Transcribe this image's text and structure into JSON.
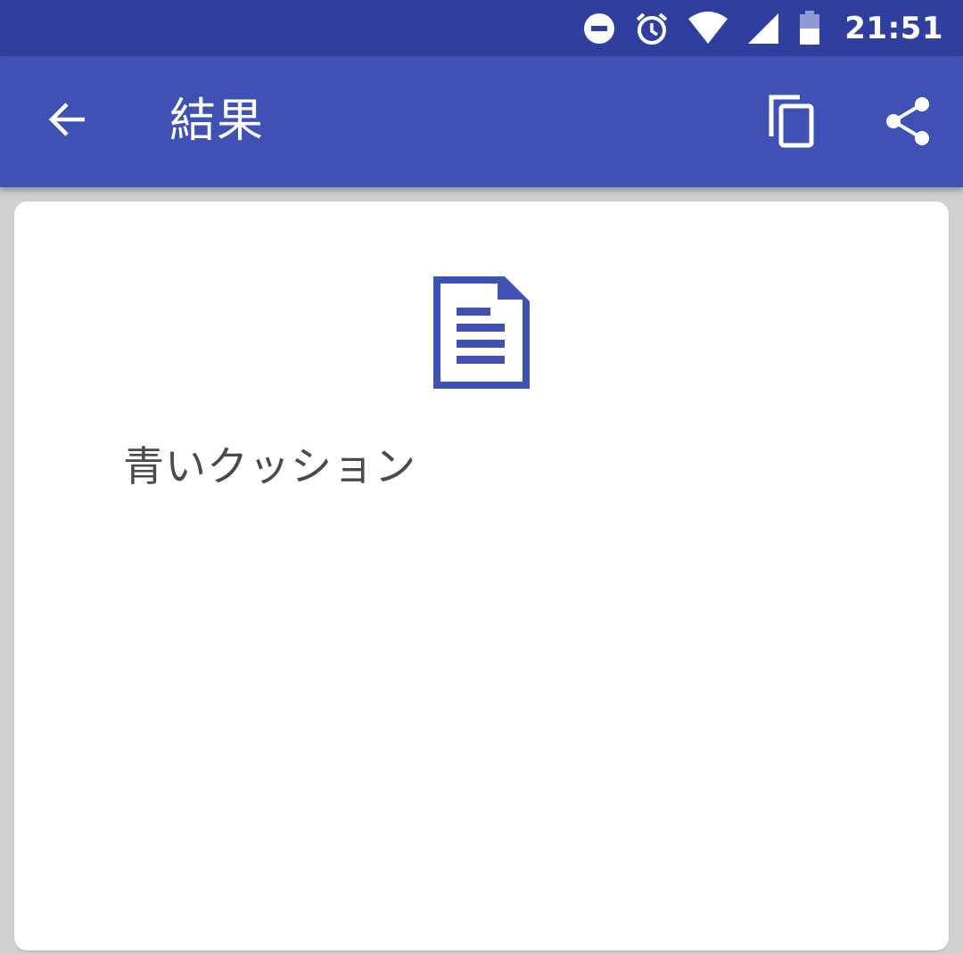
{
  "status_bar": {
    "time": "21:51",
    "icons": [
      "do-not-disturb-icon",
      "alarm-icon",
      "wifi-icon",
      "cell-signal-icon",
      "battery-icon"
    ]
  },
  "app_bar": {
    "title": "結果",
    "back_icon": "arrow-back-icon",
    "actions": [
      "copy-icon",
      "share-icon"
    ]
  },
  "card": {
    "icon": "document-icon",
    "result_text": "青いクッション"
  },
  "colors": {
    "status_bar": "#303f9f",
    "app_bar": "#3f51b5",
    "accent": "#3f51b5",
    "background": "#d0d0d0",
    "card": "#ffffff",
    "text": "#4a4a4a"
  }
}
